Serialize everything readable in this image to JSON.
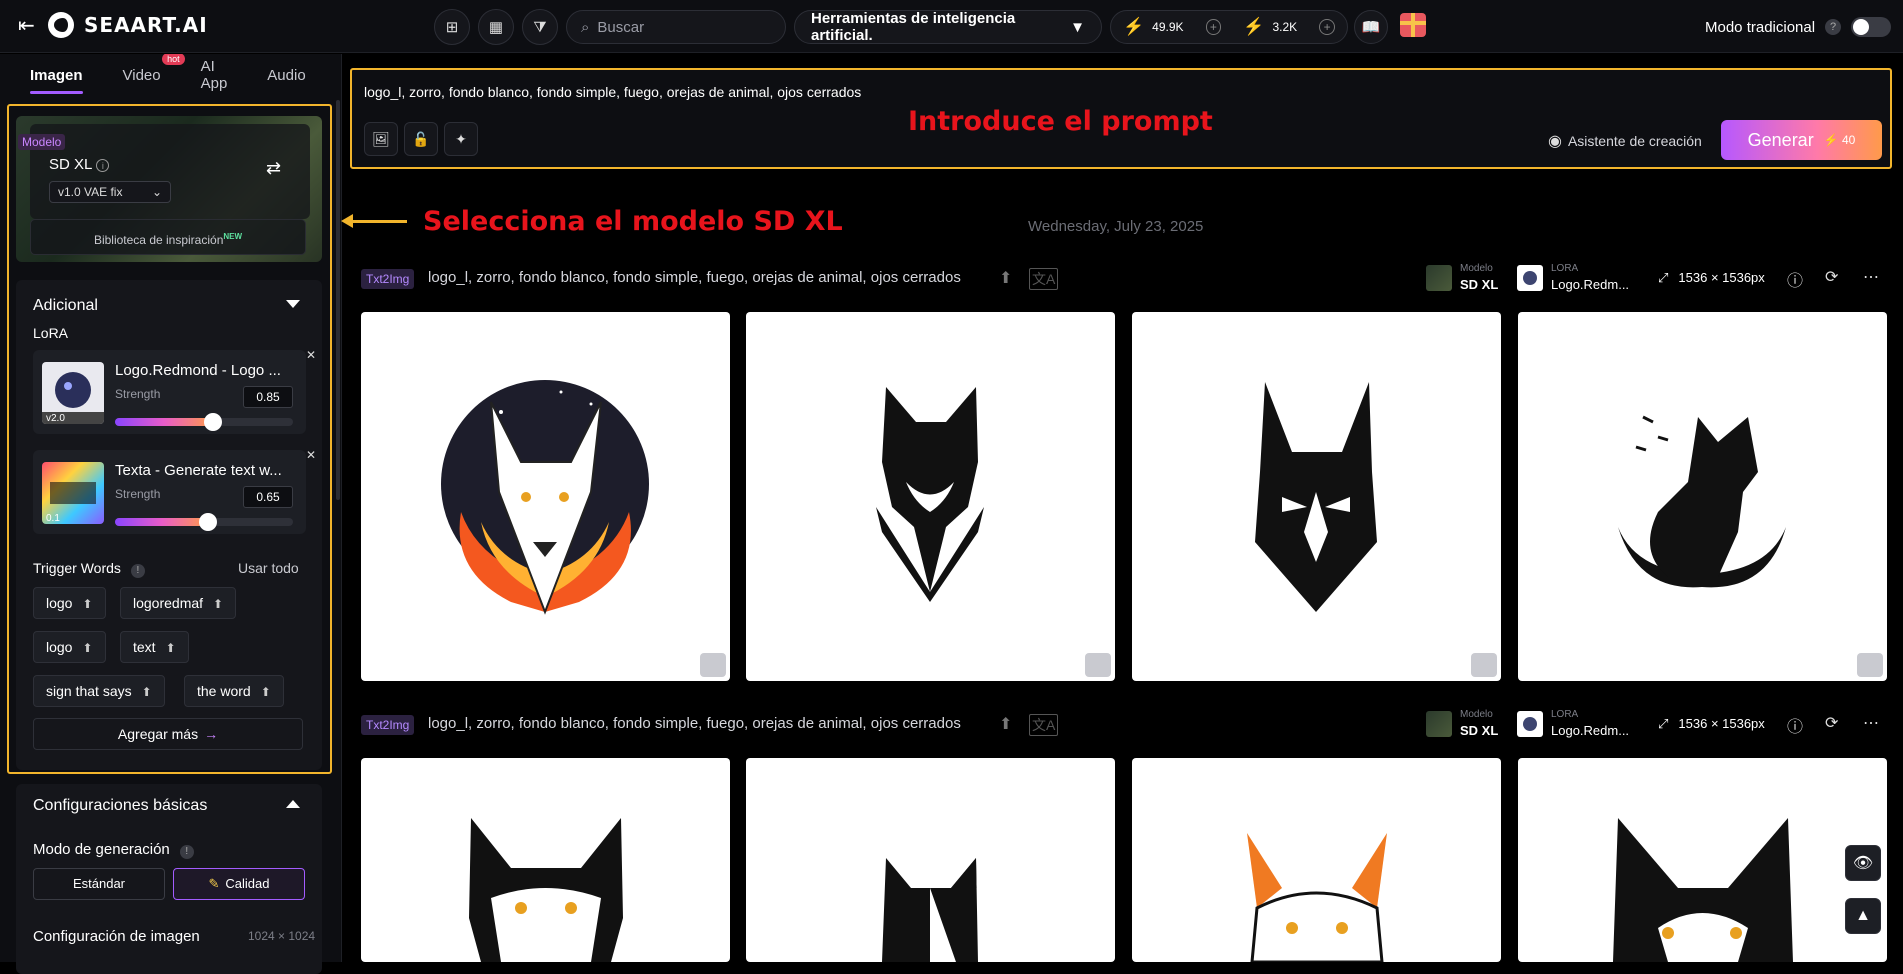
{
  "topbar": {
    "brand": "SEAART.AI",
    "search_placeholder": "Buscar",
    "tools_label": "Herramientas de inteligencia artificial.",
    "credits_a": "49.9K",
    "credits_b": "3.2K",
    "mode_label": "Modo tradicional",
    "mode_help": "?"
  },
  "sidebar": {
    "tabs": [
      {
        "label": "Imagen"
      },
      {
        "label": "Video",
        "badge": "hot"
      },
      {
        "label": "AI App"
      },
      {
        "label": "Audio"
      }
    ],
    "model": {
      "tag": "Modelo",
      "name": "SD XL",
      "vae": "v1.0 VAE fix",
      "library": "Biblioteca de inspiración",
      "library_badge": "NEW"
    },
    "additional": {
      "title": "Adicional",
      "lora_label": "LoRA",
      "loras": [
        {
          "title": "Logo.Redmond - Logo ...",
          "strength_label": "Strength",
          "strength": "0.85",
          "version": "v2.0",
          "level": 0.55
        },
        {
          "title": "Texta - Generate text w...",
          "strength_label": "Strength",
          "strength": "0.65",
          "version": "0.1",
          "level": 0.52
        }
      ],
      "trigger_title": "Trigger Words",
      "use_all": "Usar todo",
      "triggers": [
        "logo",
        "logoredmaf",
        "logo",
        "text",
        "sign that says",
        "the word"
      ],
      "add_more": "Agregar más"
    },
    "basic": {
      "title": "Configuraciones básicas",
      "gen_mode_label": "Modo de generación",
      "standard": "Estándar",
      "quality": "Calidad",
      "image_config": "Configuración de imagen",
      "image_size": "1024 × 1024"
    }
  },
  "main": {
    "prompt": "logo_l, zorro, fondo blanco, fondo simple, fuego, orejas de animal, ojos cerrados",
    "assistant": "Asistente de creación",
    "generate": "Generar",
    "generate_cost": "40",
    "annotation_prompt": "Introduce el prompt",
    "annotation_model": "Selecciona el modelo SD XL",
    "date": "Wednesday, July 23, 2025",
    "rows": [
      {
        "tag": "Txt2Img",
        "prompt": "logo_l, zorro, fondo blanco, fondo simple, fuego, orejas de animal, ojos cerrados",
        "model_key": "Modelo",
        "model_val": "SD XL",
        "lora_key": "LORA",
        "lora_val": "Logo.Redm...",
        "resolution": "1536 × 1536px"
      },
      {
        "tag": "Txt2Img",
        "prompt": "logo_l, zorro, fondo blanco, fondo simple, fuego, orejas de animal, ojos cerrados",
        "model_key": "Modelo",
        "model_val": "SD XL",
        "lora_key": "LORA",
        "lora_val": "Logo.Redm...",
        "resolution": "1536 × 1536px"
      }
    ]
  },
  "colors": {
    "accent": "#a35cff",
    "highlight": "#f2b52c",
    "annotation": "#e8141c"
  }
}
